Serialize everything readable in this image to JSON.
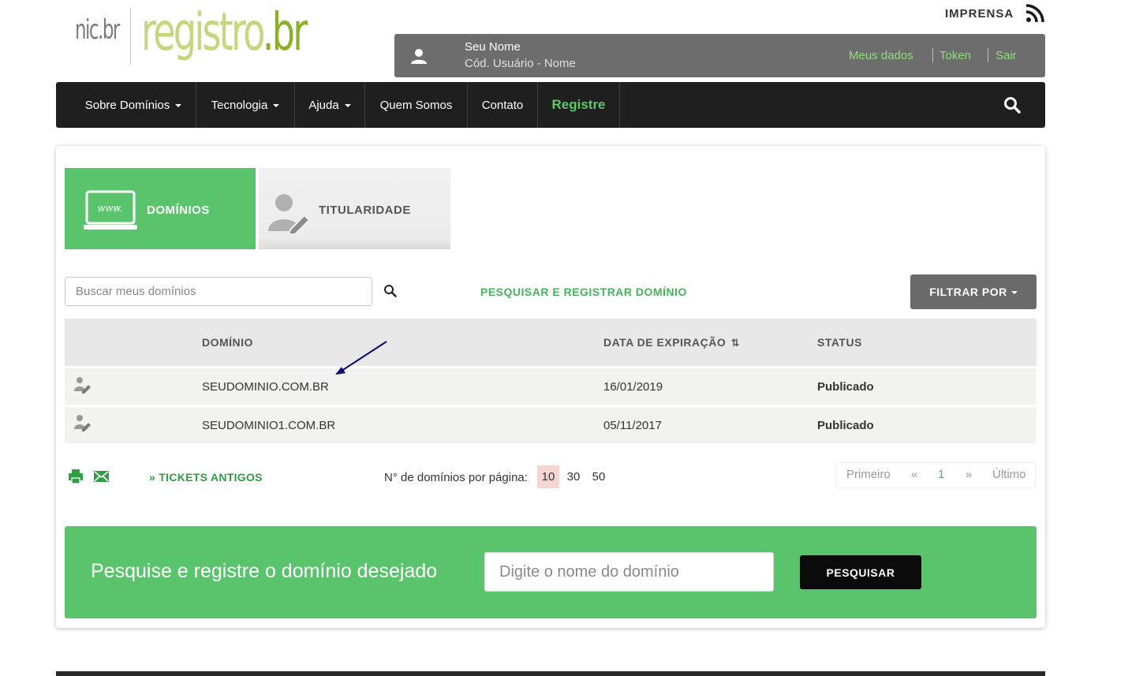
{
  "logo": {
    "nic": "nic.br",
    "registro": "registro",
    "br": ".br"
  },
  "top": {
    "imprensa": "IMPRENSA"
  },
  "user": {
    "name": "Seu Nome",
    "code": "Cód. Usuário - Nome",
    "links": [
      "Meus dados",
      "Token",
      "Sair"
    ]
  },
  "nav": {
    "items": [
      "Sobre Domínios",
      "Tecnologia",
      "Ajuda",
      "Quem Somos",
      "Contato",
      "Registre"
    ]
  },
  "tabs": {
    "dominios": "DOMÍNIOS",
    "titularidade": "TITULARIDADE"
  },
  "search": {
    "placeholder": "Buscar meus domínios",
    "register_link": "PESQUISAR E REGISTRAR DOMÍNIO",
    "filter": "FILTRAR POR"
  },
  "table": {
    "headers": {
      "domain": "DOMÍNIO",
      "expiry": "DATA DE EXPIRAÇÃO",
      "status": "STATUS"
    },
    "rows": [
      {
        "domain": "SEUDOMINIO.COM.BR",
        "expiry": "16/01/2019",
        "status": "Publicado"
      },
      {
        "domain": "SEUDOMINIO1.COM.BR",
        "expiry": "05/11/2017",
        "status": "Publicado"
      }
    ]
  },
  "toolbar": {
    "tickets": "» TICKETS ANTIGOS",
    "per_page_label": "N° de domínios por página:",
    "per_page_options": [
      "10",
      "30",
      "50"
    ],
    "pager": {
      "first": "Primeiro",
      "prev": "«",
      "current": "1",
      "next": "»",
      "last": "Último"
    }
  },
  "cta": {
    "text": "Pesquise e registre o domínio desejado",
    "placeholder": "Digite o nome do domínio",
    "button": "PESQUISAR"
  },
  "colors": {
    "green": "#5ac46c",
    "dark": "#1f1f1f",
    "gray": "#6d6d6d"
  }
}
